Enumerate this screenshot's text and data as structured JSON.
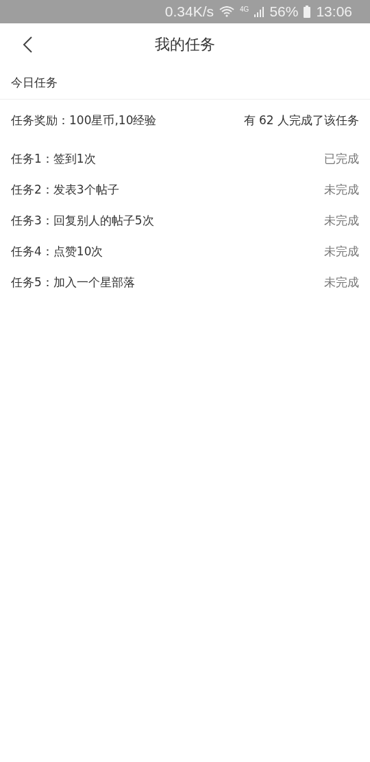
{
  "status_bar": {
    "speed": "0.34K/s",
    "network": "4G",
    "battery": "56%",
    "time": "13:06"
  },
  "header": {
    "title": "我的任务"
  },
  "section": {
    "title": "今日任务"
  },
  "reward": {
    "text": "任务奖励：100星币,10经验",
    "completed_count": "有 62 人完成了该任务"
  },
  "tasks": [
    {
      "name": "任务1：签到1次",
      "status": "已完成"
    },
    {
      "name": "任务2：发表3个帖子",
      "status": "未完成"
    },
    {
      "name": "任务3：回复别人的帖子5次",
      "status": "未完成"
    },
    {
      "name": "任务4：点赞10次",
      "status": "未完成"
    },
    {
      "name": "任务5：加入一个星部落",
      "status": "未完成"
    }
  ]
}
